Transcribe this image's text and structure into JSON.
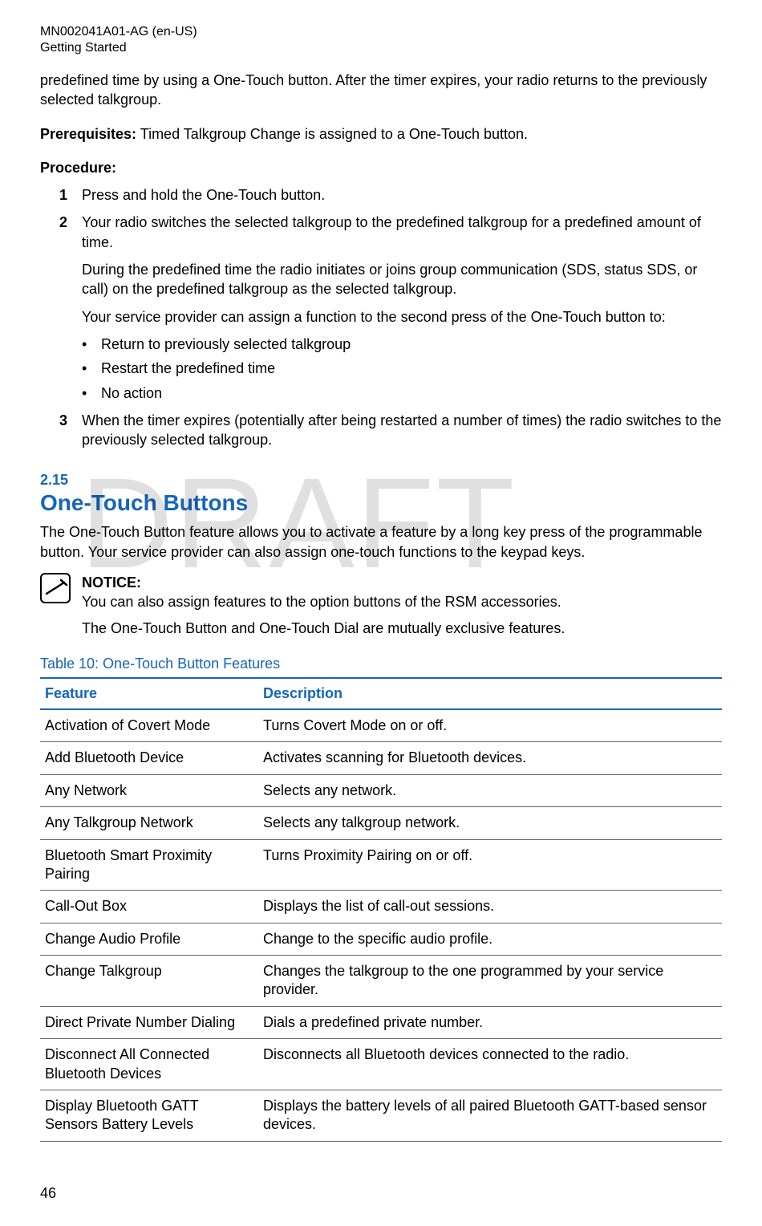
{
  "header": {
    "doc_id": "MN002041A01-AG (en-US)",
    "section": "Getting Started"
  },
  "watermark": "DRAFT",
  "intro_para": "predefined time by using a One-Touch button. After the timer expires, your radio returns to the previously selected talkgroup.",
  "prereq_label": "Prerequisites:",
  "prereq_text": " Timed Talkgroup Change is assigned to a One-Touch button.",
  "procedure_label": "Procedure:",
  "steps": [
    {
      "n": "1",
      "paras": [
        "Press and hold the One-Touch button."
      ]
    },
    {
      "n": "2",
      "paras": [
        "Your radio switches the selected talkgroup to the predefined talkgroup for a predefined amount of time.",
        "During the predefined time the radio initiates or joins group communication (SDS, status SDS, or call) on the predefined talkgroup as the selected talkgroup.",
        "Your service provider can assign a function to the second press of the One-Touch button to:"
      ],
      "bullets": [
        "Return to previously selected talkgroup",
        "Restart the predefined time",
        "No action"
      ]
    },
    {
      "n": "3",
      "paras": [
        "When the timer expires (potentially after being restarted a number of times) the radio switches to the previously selected talkgroup."
      ]
    }
  ],
  "section": {
    "num": "2.15",
    "title": "One-Touch Buttons"
  },
  "section_intro": "The One-Touch Button feature allows you to activate a feature by a long key press of the programmable button. Your service provider can also assign one-touch functions to the keypad keys.",
  "notice": {
    "label": "NOTICE:",
    "lines": [
      "You can also assign features to the option buttons of the RSM accessories.",
      "The One-Touch Button and One-Touch Dial are mutually exclusive features."
    ]
  },
  "table": {
    "caption": "Table 10: One-Touch Button Features",
    "headers": [
      "Feature",
      "Description"
    ],
    "rows": [
      [
        "Activation of Covert Mode",
        "Turns Covert Mode on or off."
      ],
      [
        "Add Bluetooth Device",
        "Activates scanning for Bluetooth devices."
      ],
      [
        "Any Network",
        "Selects any network."
      ],
      [
        "Any Talkgroup Network",
        "Selects any talkgroup network."
      ],
      [
        "Bluetooth Smart Proximity Pairing",
        "Turns Proximity Pairing on or off."
      ],
      [
        "Call-Out Box",
        "Displays the list of call-out sessions."
      ],
      [
        "Change Audio Profile",
        "Change to the specific audio profile."
      ],
      [
        "Change Talkgroup",
        "Changes the talkgroup to the one programmed by your service provider."
      ],
      [
        "Direct Private Number Dialing",
        "Dials a predefined private number."
      ],
      [
        "Disconnect All Connected Bluetooth Devices",
        "Disconnects all Bluetooth devices connected to the radio."
      ],
      [
        "Display Bluetooth GATT Sensors Battery Levels",
        "Displays the battery levels of all paired Bluetooth GATT-based sensor devices."
      ]
    ]
  },
  "page_number": "46"
}
